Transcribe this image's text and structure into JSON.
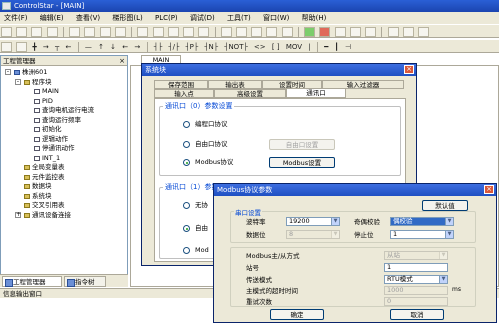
{
  "app": {
    "title": "ControlStar - [MAIN]"
  },
  "menu": [
    "文件(F)",
    "编辑(E)",
    "查看(V)",
    "梯形图(L)",
    "PLC(P)",
    "调试(D)",
    "工具(T)",
    "窗口(W)",
    "帮助(H)"
  ],
  "project_panel": {
    "title": "工程管理器",
    "close_label": "×",
    "tree": [
      {
        "label": "株洲601",
        "level": 0,
        "expander": "-"
      },
      {
        "label": "程序块",
        "level": 1,
        "expander": "-"
      },
      {
        "label": "MAIN",
        "level": 2
      },
      {
        "label": "PID",
        "level": 2
      },
      {
        "label": "查询电机运行电流",
        "level": 2
      },
      {
        "label": "查询运行频率",
        "level": 2
      },
      {
        "label": "初始化",
        "level": 2
      },
      {
        "label": "逻辑动作",
        "level": 2
      },
      {
        "label": "停通讯动作",
        "level": 2
      },
      {
        "label": "INT_1",
        "level": 2
      },
      {
        "label": "全局变量表",
        "level": 1
      },
      {
        "label": "元件监控表",
        "level": 1
      },
      {
        "label": "数据块",
        "level": 1
      },
      {
        "label": "系统块",
        "level": 1
      },
      {
        "label": "交叉引用表",
        "level": 1
      },
      {
        "label": "通讯设备连接",
        "level": 1,
        "expander": "+"
      }
    ],
    "tabs": [
      "工程管理器",
      "指令树"
    ]
  },
  "output_window": {
    "title": "信息输出窗口"
  },
  "main_tab": "MAIN",
  "system_dialog": {
    "title": "系统块",
    "close_label": "×",
    "tabs_row1": [
      "保存范围",
      "输出表",
      "设置时间",
      "输入过滤器"
    ],
    "tabs_row2": [
      "输入点",
      "高级设置",
      "通讯口"
    ],
    "group0_title": "通讯口（0）参数设置",
    "group0_options": [
      "编程口协议",
      "自由口协议",
      "Modbus协议"
    ],
    "group0_free_btn": "自由口设置",
    "group0_modbus_btn": "Modbus设置",
    "group1_title": "通讯口（1）参数设",
    "group1_options": [
      "无协",
      "自由",
      "Mod"
    ]
  },
  "modbus_dialog": {
    "title": "Modbus协议参数",
    "close_label": "×",
    "default_btn": "默认值",
    "section_title": "串口设置",
    "baud_label": "波特率",
    "baud_value": "19200",
    "parity_label": "奇偶校验",
    "parity_value": "偶校验",
    "databits_label": "数据位",
    "databits_value": "8",
    "stopbits_label": "停止位",
    "stopbits_value": "1",
    "mode_label": "Modbus主/从方式",
    "mode_value": "从站",
    "station_label": "站号",
    "station_value": "1",
    "transfer_label": "传送模式",
    "transfer_value": "RTU模式",
    "timeout_label": "主模式的超时时间",
    "timeout_value": "1000",
    "timeout_unit": "ms",
    "retry_label": "重试次数",
    "retry_value": "0",
    "ok_btn": "确定",
    "cancel_btn": "取消"
  }
}
